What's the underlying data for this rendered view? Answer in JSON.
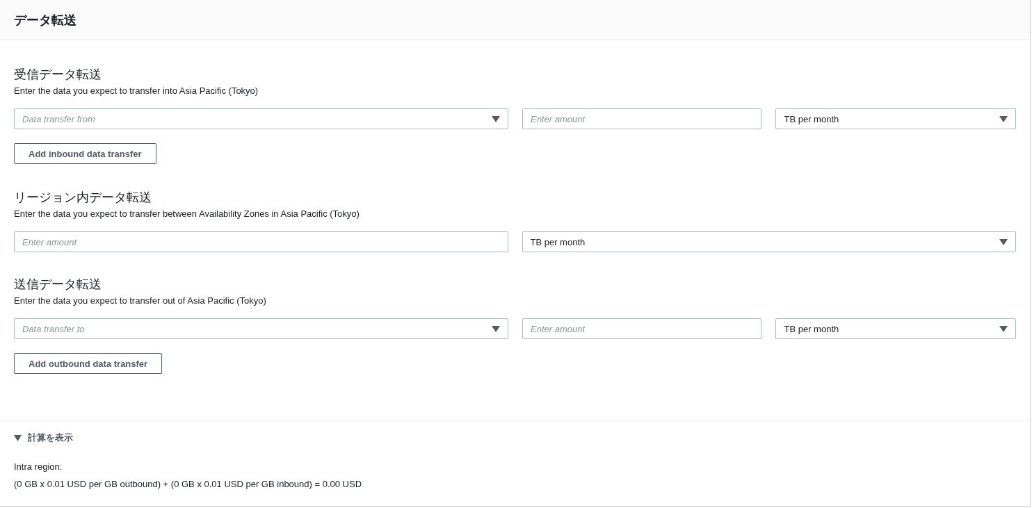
{
  "panel": {
    "title": "データ転送"
  },
  "sections": [
    {
      "title": "受信データ転送",
      "description": "Enter the data you expect to transfer into Asia Pacific (Tokyo)",
      "fields": [
        {
          "kind": "select",
          "placeholder": "Data transfer from"
        },
        {
          "kind": "input",
          "placeholder": "Enter amount"
        },
        {
          "kind": "select",
          "value": "TB per month"
        }
      ],
      "button": "Add inbound data transfer"
    },
    {
      "title": "リージョン内データ転送",
      "description": "Enter the data you expect to transfer between Availability Zones in Asia Pacific (Tokyo)",
      "fields": [
        {
          "kind": "input",
          "placeholder": "Enter amount"
        },
        {
          "kind": "select",
          "value": "TB per month"
        }
      ]
    },
    {
      "title": "送信データ転送",
      "description": "Enter the data you expect to transfer out of Asia Pacific (Tokyo)",
      "fields": [
        {
          "kind": "select",
          "placeholder": "Data transfer to"
        },
        {
          "kind": "input",
          "placeholder": "Enter amount"
        },
        {
          "kind": "select",
          "value": "TB per month"
        }
      ],
      "button": "Add outbound data transfer"
    }
  ],
  "calculation": {
    "label": "計算を表示",
    "expanded": true,
    "lines": [
      "Intra region:",
      "(0 GB x 0.01 USD per GB outbound) + (0 GB x 0.01 USD per GB inbound) = 0.00 USD"
    ]
  }
}
